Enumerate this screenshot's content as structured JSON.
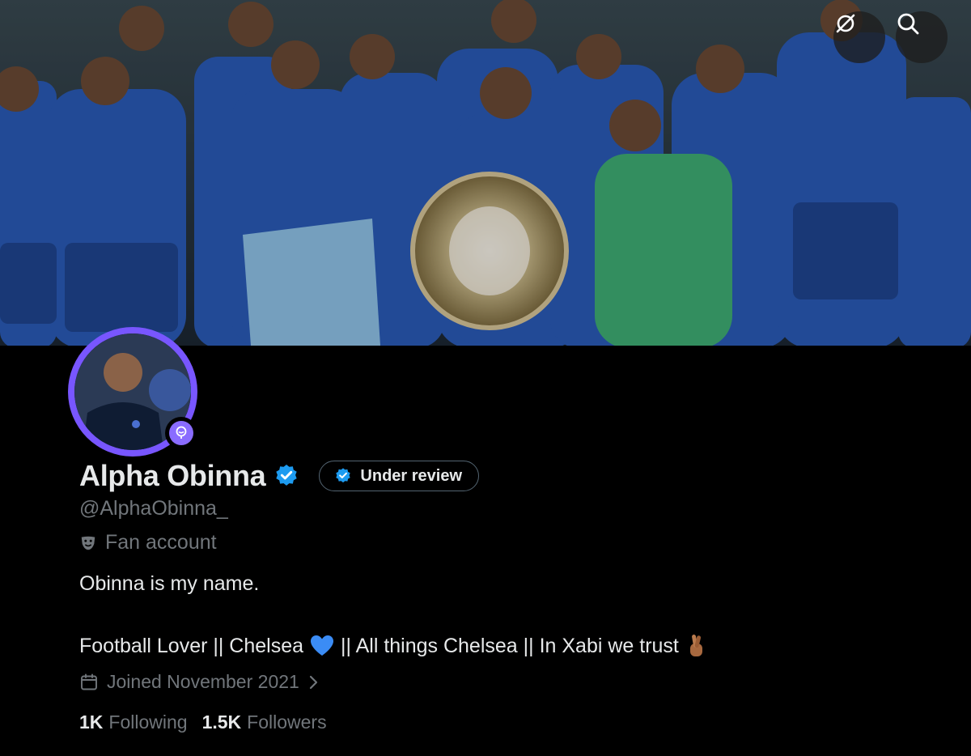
{
  "header": {
    "link_icon": "no-link-icon",
    "search_icon": "search-icon"
  },
  "profile": {
    "display_name": "Alpha Obinna",
    "review_label": "Under review",
    "handle": "@AlphaObinna_",
    "category_label": "Fan account",
    "bio_line1": "Obinna is my name.",
    "bio_line2_a": "Football Lover || Chelsea",
    "bio_line2_emoji": "💙",
    "bio_line2_b": "|| All things Chelsea || In Xabi we trust",
    "bio_line2_emoji2": "🤞🏾",
    "joined": "Joined November 2021",
    "following_count": "1K",
    "following_label": "Following",
    "followers_count": "1.5K",
    "followers_label": "Followers"
  },
  "colors": {
    "background": "#000000",
    "text_primary": "#e7e9ea",
    "text_secondary": "#71767b",
    "verified_blue": "#1d9bf0",
    "avatar_ring": "#7856ff"
  }
}
